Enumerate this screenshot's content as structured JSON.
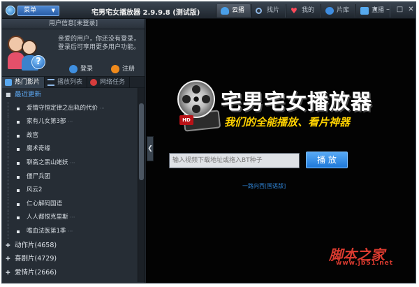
{
  "titlebar": {
    "menu_label": "菜单",
    "app_title": "宅男宅女播放器 2.9.9.8 (测试版)",
    "nav_tabs": [
      {
        "label": "云播",
        "icon": "cloud-icon"
      },
      {
        "label": "找片",
        "icon": "search-icon"
      },
      {
        "label": "我的",
        "icon": "heart-icon"
      },
      {
        "label": "片库",
        "icon": "film-icon"
      },
      {
        "label": "直播",
        "icon": "tv-icon"
      }
    ]
  },
  "user": {
    "header": "用户信息[未登录]",
    "message": "亲爱的用户，你还没有登录，登录后可享用更多用户功能。",
    "login_label": "登录",
    "register_label": "注册"
  },
  "left_tabs": [
    {
      "label": "热门影片"
    },
    {
      "label": "播放列表"
    },
    {
      "label": "网络任务"
    }
  ],
  "tree": {
    "recent": "最近更新",
    "items": [
      {
        "label": "爱情守恒定律之出轨的代价",
        "more": "⋯"
      },
      {
        "label": "家有儿女第3部",
        "more": "⋯"
      },
      {
        "label": "故宫",
        "more": ""
      },
      {
        "label": "魔术奇缘",
        "more": ""
      },
      {
        "label": "聊斋之黑山姥妖",
        "more": "⋯"
      },
      {
        "label": "僵尸兵团",
        "more": ""
      },
      {
        "label": "风云2",
        "more": ""
      },
      {
        "label": "仁心解码国语",
        "more": ""
      },
      {
        "label": "人人都恨克里斯",
        "more": "⋯"
      },
      {
        "label": "嗜血法医第1季",
        "more": "⋯"
      }
    ],
    "categories": [
      {
        "label": "动作片(4658)"
      },
      {
        "label": "喜剧片(4729)"
      },
      {
        "label": "爱情片(2666)"
      }
    ]
  },
  "main": {
    "brand_title": "宅男宅女播放器",
    "slogan": "我们的全能播放、看片神器",
    "hd_badge": "HD",
    "input_placeholder": "输入视频下载地址或拖入BT种子",
    "play_label": "播 放",
    "sample_link": "一路向西[国语版]"
  },
  "watermark": {
    "text": "脚本之家",
    "url": "www.jb51.net"
  },
  "colors": {
    "accent_blue": "#1e78d8",
    "selected_text": "#5da9f4",
    "slogan_yellow": "#ffd200",
    "watermark_red": "#d93a2f"
  }
}
